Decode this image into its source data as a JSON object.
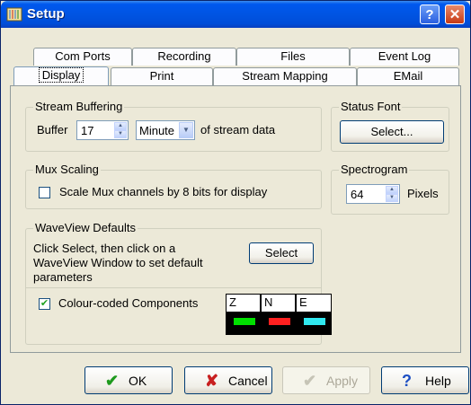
{
  "window": {
    "title": "Setup"
  },
  "titlebar": {
    "help_glyph": "?",
    "close_glyph": "✕"
  },
  "tabs": {
    "row1": [
      "Com Ports",
      "Recording",
      "Files",
      "Event Log"
    ],
    "row2": [
      "Display",
      "Print",
      "Stream Mapping",
      "EMail"
    ],
    "active": "Display"
  },
  "stream_buffering": {
    "legend": "Stream Buffering",
    "buffer_label": "Buffer",
    "buffer_value": "17",
    "unit_value": "Minute",
    "suffix": "of stream data"
  },
  "status_font": {
    "legend": "Status Font",
    "select_label": "Select..."
  },
  "mux_scaling": {
    "legend": "Mux Scaling",
    "checkbox_label": "Scale Mux channels by 8 bits for display",
    "checked": false
  },
  "spectrogram": {
    "legend": "Spectrogram",
    "value": "64",
    "unit": "Pixels"
  },
  "waveview": {
    "legend": "WaveView Defaults",
    "instructions_line1": "Click Select, then click on a",
    "instructions_line2": "WaveView Window to set default",
    "instructions_line3": "parameters",
    "select_label": "Select",
    "colour_label": "Colour-coded Components",
    "colour_checked": true,
    "components": [
      {
        "letter": "Z",
        "color": "#00E000"
      },
      {
        "letter": "N",
        "color": "#FF2020"
      },
      {
        "letter": "E",
        "color": "#30E8F0"
      }
    ]
  },
  "buttons": {
    "ok": "OK",
    "cancel": "Cancel",
    "apply": "Apply",
    "help": "Help",
    "apply_enabled": false
  }
}
